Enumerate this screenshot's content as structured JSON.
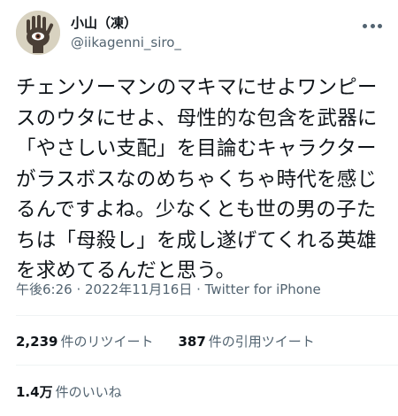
{
  "author": {
    "display_name": "小山（凍）",
    "handle": "@iikagenni_siro_",
    "avatar_icon": "hand-eye-avatar-icon"
  },
  "tweet": {
    "text": "チェンソーマンのマキマにせよワンピースのウタにせよ、母性的な包含を武器に「やさしい支配」を目論むキャラクターがラスボスなのめちゃくちゃ時代を感じるんですよね。少なくとも世の男の子たちは「母殺し」を成し遂げてくれる英雄を求めてるんだと思う。",
    "timestamp": "午後6:26 · 2022年11月16日",
    "separator": " · ",
    "source": "Twitter for iPhone"
  },
  "stats": {
    "retweets_count": "2,239",
    "retweets_label": "件のリツイート",
    "quotes_count": "387",
    "quotes_label": "件の引用ツイート",
    "likes_count": "1.4万",
    "likes_label": "件のいいね"
  },
  "colors": {
    "text_primary": "#0f1419",
    "text_secondary": "#536471",
    "divider": "#eff3f4"
  }
}
